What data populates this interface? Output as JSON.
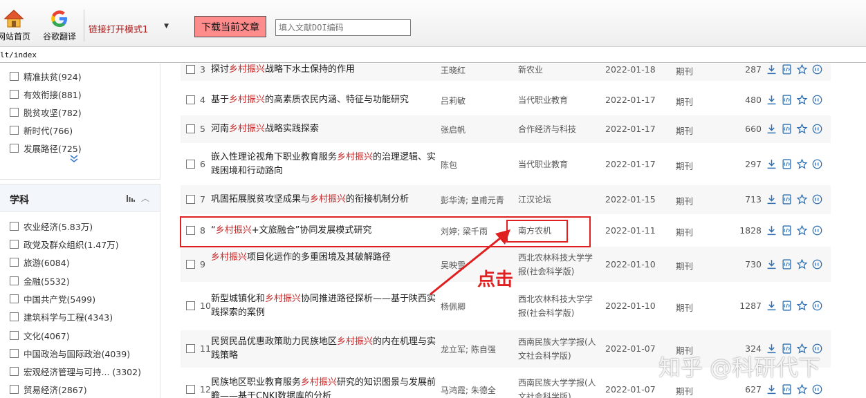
{
  "toolbar": {
    "home_label": "网站首页",
    "translate_label": "谷歌翻译",
    "mode_select_value": "链接打开模式1",
    "download_label": "下载当前文章",
    "doi_placeholder": "填入文献DOI编码"
  },
  "url": "lt/index",
  "sidebar": {
    "topic_items": [
      {
        "label": "精准扶贫(924)"
      },
      {
        "label": "有效衔接(881)"
      },
      {
        "label": "脱贫攻坚(782)"
      },
      {
        "label": "新时代(766)"
      },
      {
        "label": "发展路径(725)"
      }
    ],
    "subject_title": "学科",
    "subject_items": [
      {
        "label": "农业经济(5.83万)"
      },
      {
        "label": "政党及群众组织(1.47万)"
      },
      {
        "label": "旅游(6084)"
      },
      {
        "label": "金融(5532)"
      },
      {
        "label": "中国共产党(5499)"
      },
      {
        "label": "建筑科学与工程(4343)"
      },
      {
        "label": "文化(4067)"
      },
      {
        "label": "中国政治与国际政治(4039)"
      },
      {
        "label": "宏观经济管理与可持...  (3302)"
      },
      {
        "label": "贸易经济(2867)"
      }
    ]
  },
  "results": {
    "rows": [
      {
        "num": "3",
        "pre": "探讨",
        "kw": "乡村振兴",
        "post": "战略下水土保持的作用",
        "author": "王晓红",
        "source": "新农业",
        "date": "2022-01-18",
        "type": "期刊",
        "downloads": "287"
      },
      {
        "num": "4",
        "pre": "基于",
        "kw": "乡村振兴",
        "post": "的高素质农民内涵、特征与功能研究",
        "author": "吕莉敏",
        "source": "当代职业教育",
        "date": "2022-01-17",
        "type": "期刊",
        "downloads": "480"
      },
      {
        "num": "5",
        "pre": "河南",
        "kw": "乡村振兴",
        "post": "战略实践探索",
        "author": "张启帆",
        "source": "合作经济与科技",
        "date": "2022-01-17",
        "type": "期刊",
        "downloads": "660"
      },
      {
        "num": "6",
        "pre": "嵌入性理论视角下职业教育服务",
        "kw": "乡村振兴",
        "post": "的治理逻辑、实践困境和行动路向",
        "author": "陈包",
        "source": "当代职业教育",
        "date": "2022-01-17",
        "type": "期刊",
        "downloads": "297"
      },
      {
        "num": "7",
        "pre": "巩固拓展脱贫攻坚成果与",
        "kw": "乡村振兴",
        "post": "的衔接机制分析",
        "author": "彭华涛; 皇甫元青",
        "source": "江汉论坛",
        "date": "2022-01-15",
        "type": "期刊",
        "downloads": "713"
      },
      {
        "num": "8",
        "pre": "“",
        "kw": "乡村振兴",
        "post": "+文旅融合”协同发展模式研究",
        "author": "刘婷; 梁千雨",
        "source": "南方农机",
        "date": "2022-01-11",
        "type": "期刊",
        "downloads": "1828"
      },
      {
        "num": "9",
        "pre": "",
        "kw": "乡村振兴",
        "post": "项目化运作的多重困境及其破解路径",
        "author": "吴映雪",
        "source": "西北农林科技大学学报(社会科学版)",
        "date": "2022-01-10",
        "type": "期刊",
        "downloads": "730"
      },
      {
        "num": "10",
        "pre": "新型城镇化和",
        "kw": "乡村振兴",
        "post": "协同推进路径探析——基于陕西实践探索的案例",
        "author": "杨佩卿",
        "source": "西北农林科技大学学报(社会科学版)",
        "date": "2022-01-10",
        "type": "期刊",
        "downloads": "1287"
      },
      {
        "num": "11",
        "pre": "民贸民品优惠政策助力民族地区",
        "kw": "乡村振兴",
        "post": "的内在机理与实践策略",
        "author": "龙立军; 陈自强",
        "source": "西南民族大学学报(人文社会科学版)",
        "date": "2022-01-07",
        "type": "期刊",
        "downloads": "324"
      },
      {
        "num": "12",
        "pre": "民族地区职业教育服务",
        "kw": "乡村振兴",
        "post": "研究的知识图景与发展前瞻——基于CNKI数据库的分析",
        "author": "马鸿霞; 朱德全",
        "source": "西南民族大学学报(人文社会科学版)",
        "date": "2022-01-07",
        "type": "期刊",
        "downloads": "627"
      }
    ]
  },
  "annotation": {
    "click_label": "点击",
    "color": "#e02020"
  },
  "watermark": "知乎 @科研代下",
  "colors": {
    "keyword": "#c62828",
    "download_button": "#ff8c8c",
    "icon_blue": "#2f6fb0"
  }
}
